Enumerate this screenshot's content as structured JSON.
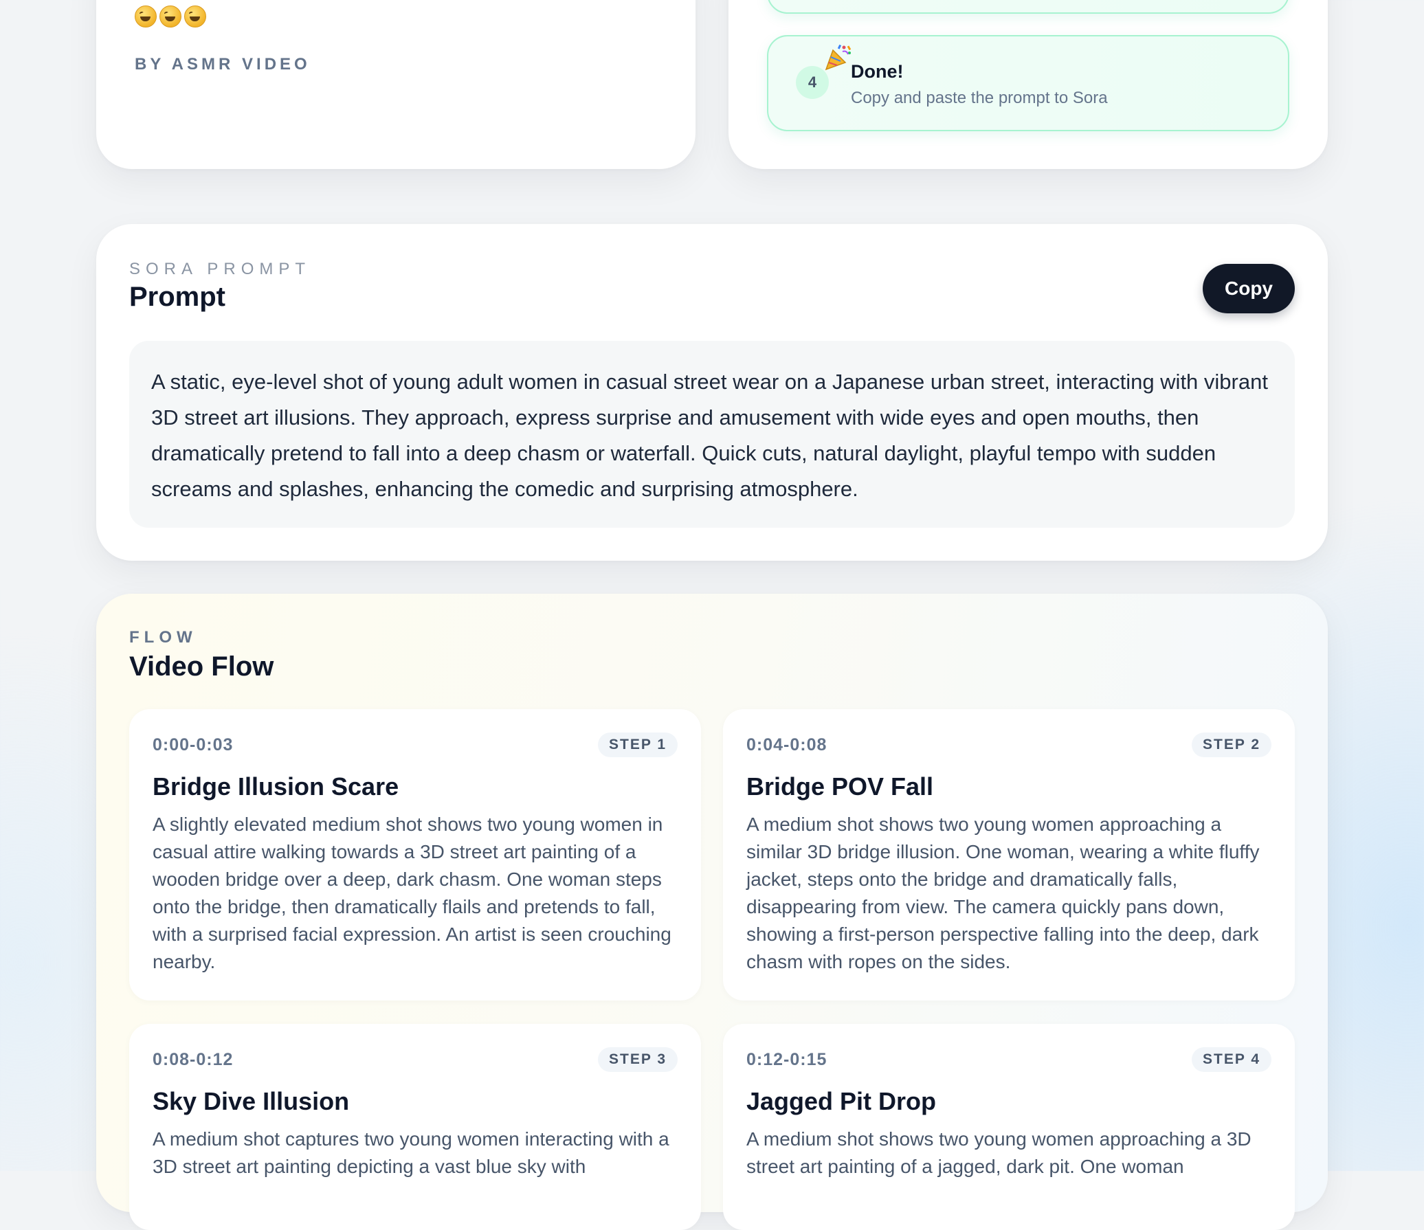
{
  "header_card": {
    "emoji_count": 3,
    "emoji_icon": "rolling-on-floor-laughing-icon",
    "byline": "BY ASMR VIDEO"
  },
  "steps_card": {
    "step4": {
      "number": "4",
      "icon": "party-popper-icon",
      "title": "Done!",
      "description": "Copy and paste the prompt to Sora"
    }
  },
  "prompt_card": {
    "eyebrow": "SORA PROMPT",
    "title": "Prompt",
    "copy_label": "Copy",
    "text": "A static, eye-level shot of young adult women in casual street wear on a Japanese urban street, interacting with vibrant 3D street art illusions. They approach, express surprise and amusement with wide eyes and open mouths, then dramatically pretend to fall into a deep chasm or waterfall. Quick cuts, natural daylight, playful tempo with sudden screams and splashes, enhancing the comedic and surprising atmosphere."
  },
  "flow_card": {
    "eyebrow": "FLOW",
    "title": "Video Flow",
    "steps": [
      {
        "time": "0:00-0:03",
        "badge": "STEP 1",
        "title": "Bridge Illusion Scare",
        "description": "A slightly elevated medium shot shows two young women in casual attire walking towards a 3D street art painting of a wooden bridge over a deep, dark chasm. One woman steps onto the bridge, then dramatically flails and pretends to fall, with a surprised facial expression. An artist is seen crouching nearby."
      },
      {
        "time": "0:04-0:08",
        "badge": "STEP 2",
        "title": "Bridge POV Fall",
        "description": "A medium shot shows two young women approaching a similar 3D bridge illusion. One woman, wearing a white fluffy jacket, steps onto the bridge and dramatically falls, disappearing from view. The camera quickly pans down, showing a first-person perspective falling into the deep, dark chasm with ropes on the sides."
      },
      {
        "time": "0:08-0:12",
        "badge": "STEP 3",
        "title": "Sky Dive Illusion",
        "description": "A medium shot captures two young women interacting with a 3D street art painting depicting a vast blue sky with"
      },
      {
        "time": "0:12-0:15",
        "badge": "STEP 4",
        "title": "Jagged Pit Drop",
        "description": "A medium shot shows two young women approaching a 3D street art painting of a jagged, dark pit. One woman"
      }
    ]
  },
  "colors": {
    "accent_dark": "#111827",
    "step_green_border": "#a7f3d0",
    "step_green_bg": "#ecfdf5",
    "muted_text": "#64748b"
  }
}
